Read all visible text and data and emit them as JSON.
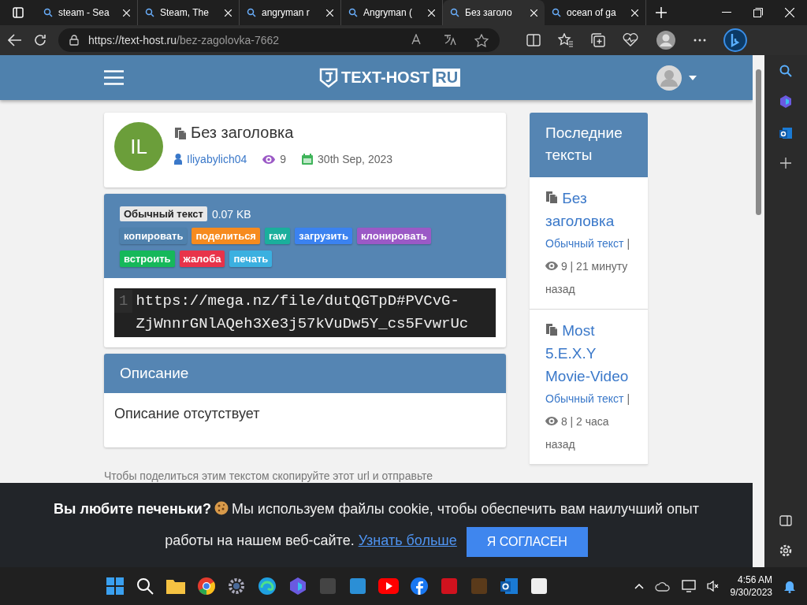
{
  "browser": {
    "tabs": [
      {
        "title": "steam - Sea",
        "selected": false
      },
      {
        "title": "Steam, The",
        "selected": false
      },
      {
        "title": "angryman r",
        "selected": false
      },
      {
        "title": "Angryman (",
        "selected": false
      },
      {
        "title": "Без заголо",
        "selected": true
      },
      {
        "title": "ocean of ga",
        "selected": false
      }
    ],
    "url_host": "https://text-host.ru",
    "url_path": "/bez-zagolovka-7662"
  },
  "header": {
    "logo_main": "TEXT-HOST",
    "logo_badge": "RU"
  },
  "paste": {
    "avatar_initials": "IL",
    "title": "Без заголовка",
    "author": "Iliyabylich04",
    "views": "9",
    "date": "30th Sep, 2023",
    "type_badge": "Обычный текст",
    "size": "0.07 KB",
    "actions": [
      {
        "label": "копировать",
        "color": "#4f81ad"
      },
      {
        "label": "поделиться",
        "color": "#f68b1f"
      },
      {
        "label": "raw",
        "color": "#1aaf9c"
      },
      {
        "label": "загрузить",
        "color": "#3b82f0"
      },
      {
        "label": "клонировать",
        "color": "#9b59c6"
      },
      {
        "label": "встроить",
        "color": "#16b85a"
      },
      {
        "label": "жалоба",
        "color": "#e8334a"
      },
      {
        "label": "печать",
        "color": "#3bb0e0"
      }
    ],
    "code": {
      "line_number": "1",
      "text": "https://mega.nz/file/dutQGTpD#PVCvG-ZjWnnrGNlAQeh3Xe3j57kVuDw5Y_cs5FvwrUc"
    }
  },
  "description": {
    "heading": "Описание",
    "text": "Описание отсутствует"
  },
  "share_hint": "Чтобы поделиться этим текстом скопируйте этот url и отправьте",
  "sidebar": {
    "heading": "Последние тексты",
    "items": [
      {
        "title": "Без заголовка",
        "type": "Обычный текст",
        "separator": "|",
        "views": "9",
        "separator_2": "|",
        "time": "21 минуту назад"
      },
      {
        "title": "Most 5.E.X.Y Movie-Video",
        "type": "Обычный текст",
        "separator": "|",
        "views": "8",
        "separator_2": "|",
        "time": "2 часа назад"
      }
    ]
  },
  "cookie": {
    "question": "Вы любите печеньки?",
    "message": "Мы используем файлы cookie, чтобы обеспечить вам наилучший опыт работы на нашем веб-сайте.",
    "link": "Узнать больше",
    "button": "Я СОГЛАСЕН"
  },
  "taskbar": {
    "time": "4:56 AM",
    "date": "9/30/2023"
  }
}
